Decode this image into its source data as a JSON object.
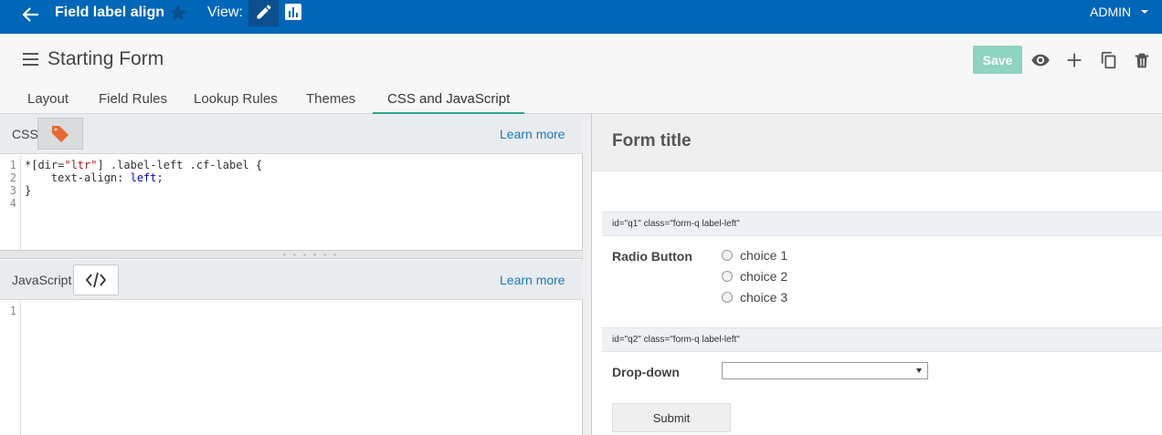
{
  "topbar": {
    "title": "Field label align",
    "view_label": "View:",
    "user": "ADMIN",
    "icons": {
      "back": "arrow-left-icon",
      "star": "star-icon",
      "edit": "pencil-icon",
      "report": "bar-chart-icon",
      "caret": "caret-down-icon"
    }
  },
  "header": {
    "form_name": "Starting Form",
    "save_label": "Save",
    "icons": [
      "eye-icon",
      "plus-icon",
      "copy-icon",
      "trash-icon"
    ],
    "tabs": [
      {
        "label": "Layout",
        "active": false
      },
      {
        "label": "Field Rules",
        "active": false
      },
      {
        "label": "Lookup Rules",
        "active": false
      },
      {
        "label": "Themes",
        "active": false
      },
      {
        "label": "CSS and JavaScript",
        "active": true
      }
    ]
  },
  "css_panel": {
    "label": "CSS",
    "learn_more": "Learn more",
    "line_numbers": [
      "1",
      "2",
      "3",
      "4"
    ],
    "code": {
      "l1_a": "*[dir=",
      "l1_str": "\"ltr\"",
      "l1_b": "] .label-left .cf-label {",
      "l2_a": "    text-align: ",
      "l2_kw": "left",
      "l2_b": ";",
      "l3": "}"
    }
  },
  "js_panel": {
    "label": "JavaScript",
    "learn_more": "Learn more",
    "line_numbers": [
      "1"
    ]
  },
  "preview": {
    "form_title": "Form title",
    "q1": {
      "id_text": "id=\"q1\" class=\"form-q label-left\"",
      "label": "Radio Button",
      "choices": [
        "choice 1",
        "choice 2",
        "choice 3"
      ]
    },
    "q2": {
      "id_text": "id=\"q2\" class=\"form-q label-left\"",
      "label": "Drop-down",
      "value": ""
    },
    "submit_label": "Submit"
  },
  "colors": {
    "topbar": "#0066b8",
    "save": "#8fd3c1",
    "active_tab": "#2ea58a",
    "link": "#1a7bc4",
    "tag": "#e8692e"
  }
}
